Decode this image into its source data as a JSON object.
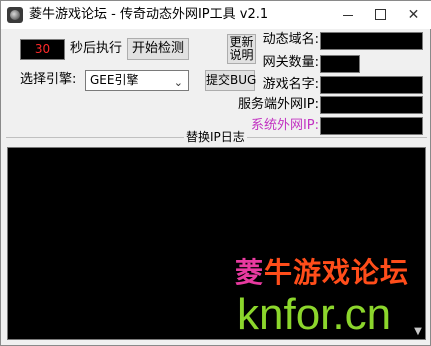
{
  "window": {
    "title": "菱牛游戏论坛 - 传奇动态外网IP工具 v2.1",
    "controls": {
      "minimize": "—",
      "maximize": "□",
      "close": "✕"
    }
  },
  "countdown": {
    "value": "30",
    "label": "秒后执行"
  },
  "buttons": {
    "start_detect": "开始检测",
    "update_notes": "更新说明",
    "submit_bug": "提交BUG"
  },
  "engine": {
    "label": "选择引擎:",
    "selected": "GEE引擎",
    "chevron": "⌄"
  },
  "fields": {
    "dynamic_domain": {
      "label": "动态域名:",
      "value": ""
    },
    "gateway_count": {
      "label": "网关数量:",
      "value": ""
    },
    "game_name": {
      "label": "游戏名字:",
      "value": ""
    },
    "server_external_ip": {
      "label": "服务端外网IP:",
      "value": ""
    },
    "system_external_ip": {
      "label": "系统外网IP:",
      "value": ""
    }
  },
  "log": {
    "title": "替换IP日志"
  },
  "watermark": {
    "line1_first": "菱",
    "line1_rest": "牛游戏论坛",
    "line2": "knfor.cn"
  },
  "colors": {
    "countdown_text": "#ff2a2a",
    "system_ip_label": "#c233c2",
    "log_background": "#000000",
    "watermark_pink": "#e83aa0",
    "watermark_orange": "#ff4d1a",
    "watermark_green": "#8cd62c"
  },
  "icons": {
    "app": "app-icon",
    "scroll_down": "scroll-down-icon"
  }
}
